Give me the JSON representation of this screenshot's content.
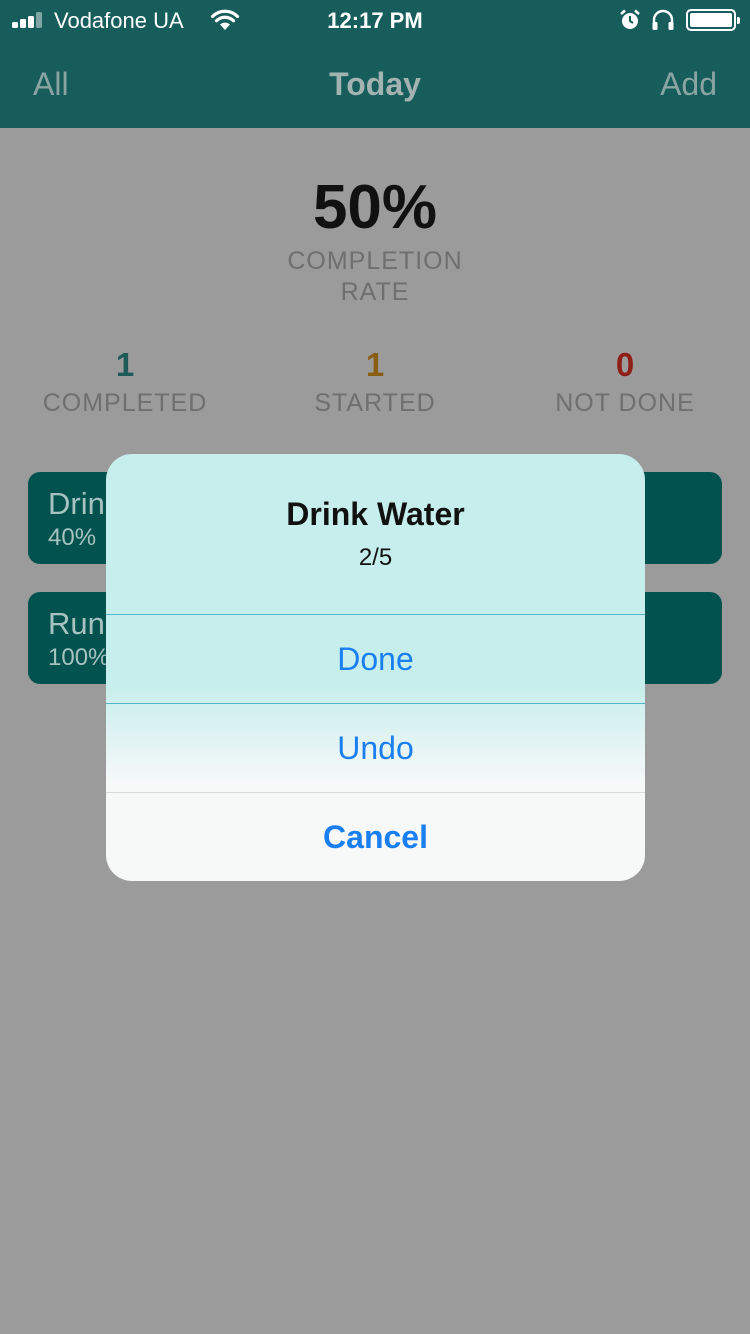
{
  "status_bar": {
    "carrier": "Vodafone UA",
    "time": "12:17 PM"
  },
  "nav": {
    "left": "All",
    "title": "Today",
    "right": "Add"
  },
  "summary": {
    "rate_value": "50%",
    "rate_label": "COMPLETION RATE",
    "stats": [
      {
        "value": "1",
        "label": "COMPLETED",
        "color": "#1d5a58"
      },
      {
        "value": "1",
        "label": "STARTED",
        "color": "#8a5e10"
      },
      {
        "value": "0",
        "label": "NOT DONE",
        "color": "#8e1f16"
      }
    ]
  },
  "habits": [
    {
      "name_visible": "Drin",
      "progress_visible": "40%"
    },
    {
      "name_visible": "Run",
      "progress_visible": "100%"
    }
  ],
  "alert": {
    "title": "Drink Water",
    "message": "2/5",
    "actions": {
      "done": "Done",
      "undo": "Undo",
      "cancel": "Cancel"
    }
  },
  "colors": {
    "nav_bar": "#165d5b",
    "card": "#02534f",
    "overlay": "#9b9b9b",
    "action_blue": "#1a7ff2",
    "alert_tint": "#c6eeec"
  }
}
